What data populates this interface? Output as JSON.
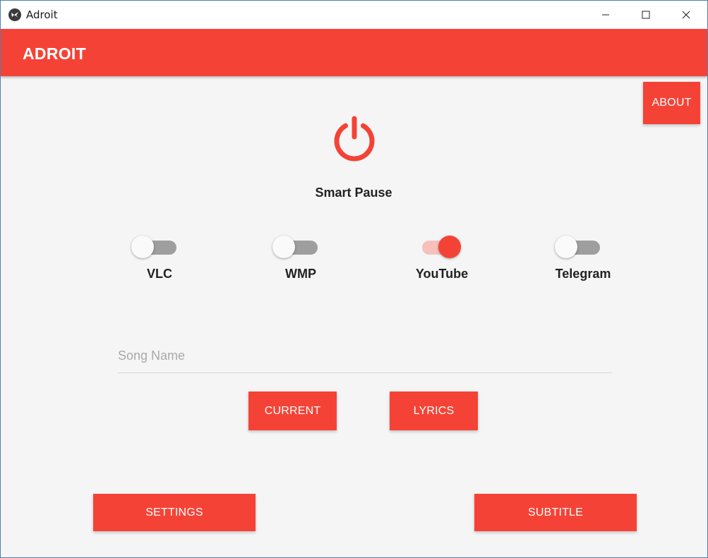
{
  "window": {
    "title": "Adroit",
    "icon": "kivy-app-icon",
    "controls": [
      "minimize-icon",
      "maximize-icon",
      "close-icon"
    ]
  },
  "appbar": {
    "title": "ADROIT"
  },
  "about_button": {
    "label": "ABOUT"
  },
  "smart_pause": {
    "icon": "power-icon",
    "label": "Smart Pause"
  },
  "toggles": [
    {
      "label": "VLC",
      "state": "off"
    },
    {
      "label": "WMP",
      "state": "off"
    },
    {
      "label": "YouTube",
      "state": "on"
    },
    {
      "label": "Telegram",
      "state": "off"
    }
  ],
  "song_input": {
    "placeholder": "Song Name",
    "value": ""
  },
  "actions": {
    "current_label": "CURRENT",
    "lyrics_label": "LYRICS",
    "settings_label": "SETTINGS",
    "subtitle_label": "SUBTITLE"
  },
  "colors": {
    "accent": "#f44336",
    "background": "#f5f5f5",
    "toggle_on_track": "#f6c1bd",
    "toggle_off_track": "#9e9e9e"
  }
}
